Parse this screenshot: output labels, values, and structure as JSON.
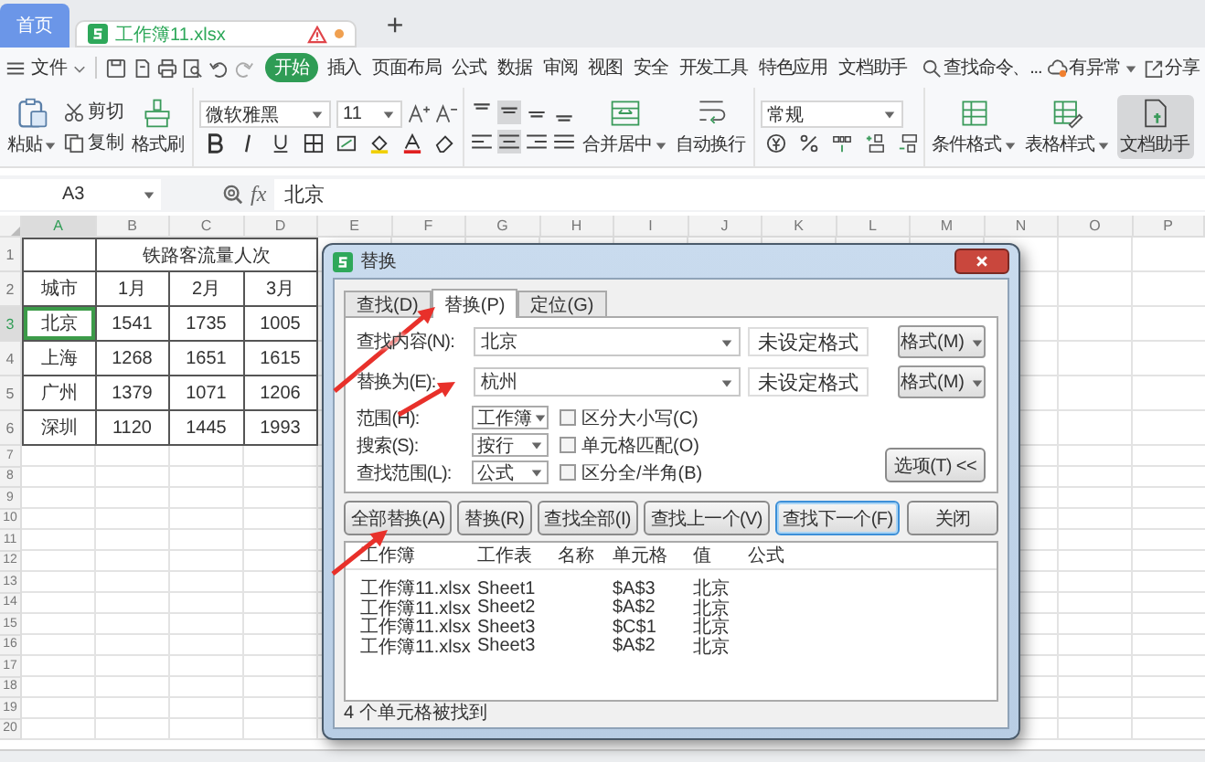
{
  "app_tabs": [
    {
      "label": "首页",
      "selected": false,
      "kind": "home"
    },
    {
      "label": "工作簿11.xlsx",
      "selected": true,
      "kind": "document"
    }
  ],
  "new_tab_button": "+",
  "menu": {
    "file": "文件",
    "tabs": [
      {
        "label": "开始",
        "selected": true
      },
      {
        "label": "插入",
        "selected": false
      },
      {
        "label": "页面布局",
        "selected": false
      },
      {
        "label": "公式",
        "selected": false
      },
      {
        "label": "数据",
        "selected": false
      },
      {
        "label": "审阅",
        "selected": false
      },
      {
        "label": "视图",
        "selected": false
      },
      {
        "label": "安全",
        "selected": false
      },
      {
        "label": "开发工具",
        "selected": false
      },
      {
        "label": "特色应用",
        "selected": false
      },
      {
        "label": "文档助手",
        "selected": false
      }
    ],
    "search": "查找命令、...",
    "status": "有异常",
    "share": "分享"
  },
  "ribbon": {
    "paste": "粘贴",
    "cut": "剪切",
    "copy": "复制",
    "format_painter": "格式刷",
    "font": "微软雅黑",
    "font_size": "11",
    "merge": "合并居中",
    "wrap": "自动换行",
    "number_format": "常规",
    "conditional_format": "条件格式",
    "table_style": "表格样式",
    "assistant": "文档助手"
  },
  "formula_bar": {
    "cell_reference": "A3",
    "fx": "fx",
    "value": "北京"
  },
  "sheet": {
    "columns": [
      {
        "label": "A",
        "selected": true
      },
      {
        "label": "B",
        "selected": false
      },
      {
        "label": "C",
        "selected": false
      },
      {
        "label": "D",
        "selected": false
      },
      {
        "label": "E",
        "selected": false
      },
      {
        "label": "F",
        "selected": false
      },
      {
        "label": "G",
        "selected": false
      },
      {
        "label": "H",
        "selected": false
      },
      {
        "label": "I",
        "selected": false
      },
      {
        "label": "J",
        "selected": false
      },
      {
        "label": "K",
        "selected": false
      },
      {
        "label": "L",
        "selected": false
      },
      {
        "label": "M",
        "selected": false
      },
      {
        "label": "N",
        "selected": false
      },
      {
        "label": "O",
        "selected": false
      },
      {
        "label": "P",
        "selected": false
      }
    ],
    "rows": [
      {
        "label": "1",
        "selected": false
      },
      {
        "label": "2",
        "selected": false
      },
      {
        "label": "3",
        "selected": true
      },
      {
        "label": "4",
        "selected": false
      },
      {
        "label": "5",
        "selected": false
      },
      {
        "label": "6",
        "selected": false
      },
      {
        "label": "7",
        "selected": false
      },
      {
        "label": "8",
        "selected": false
      },
      {
        "label": "9",
        "selected": false
      },
      {
        "label": "10",
        "selected": false
      },
      {
        "label": "11",
        "selected": false
      },
      {
        "label": "12",
        "selected": false
      },
      {
        "label": "13",
        "selected": false
      },
      {
        "label": "14",
        "selected": false
      },
      {
        "label": "15",
        "selected": false
      },
      {
        "label": "16",
        "selected": false
      },
      {
        "label": "17",
        "selected": false
      },
      {
        "label": "18",
        "selected": false
      },
      {
        "label": "19",
        "selected": false
      },
      {
        "label": "20",
        "selected": false
      }
    ],
    "title": "铁路客流量人次",
    "header": [
      "城市",
      "1月",
      "2月",
      "3月"
    ],
    "data": [
      [
        {
          "text": "北京",
          "selected": true
        },
        {
          "text": "1541",
          "selected": false
        },
        {
          "text": "1735",
          "selected": false
        },
        {
          "text": "1005",
          "selected": false
        }
      ],
      [
        {
          "text": "上海",
          "selected": false
        },
        {
          "text": "1268",
          "selected": false
        },
        {
          "text": "1651",
          "selected": false
        },
        {
          "text": "1615",
          "selected": false
        }
      ],
      [
        {
          "text": "广州",
          "selected": false
        },
        {
          "text": "1379",
          "selected": false
        },
        {
          "text": "1071",
          "selected": false
        },
        {
          "text": "1206",
          "selected": false
        }
      ],
      [
        {
          "text": "深圳",
          "selected": false
        },
        {
          "text": "1120",
          "selected": false
        },
        {
          "text": "1445",
          "selected": false
        },
        {
          "text": "1993",
          "selected": false
        }
      ]
    ]
  },
  "dialog": {
    "title": "替换",
    "tabs": [
      {
        "label": "查找(D)",
        "selected": false
      },
      {
        "label": "替换(P)",
        "selected": true
      },
      {
        "label": "定位(G)",
        "selected": false
      }
    ],
    "fields": [
      {
        "label": "查找内容(N):",
        "value": "北京",
        "format": "未设定格式",
        "format_button": "格式(M)"
      },
      {
        "label": "替换为(E):",
        "value": "杭州",
        "format": "未设定格式",
        "format_button": "格式(M)"
      }
    ],
    "options": [
      {
        "label": "范围(H):",
        "value": "工作簿",
        "checkbox": "区分大小写(C)",
        "checked": false
      },
      {
        "label": "搜索(S):",
        "value": "按行",
        "checkbox": "单元格匹配(O)",
        "checked": false
      },
      {
        "label": "查找范围(L):",
        "value": "公式",
        "checkbox": "区分全/半角(B)",
        "checked": false
      }
    ],
    "options_button": "选项(T) <<",
    "buttons": [
      {
        "label": "全部替换(A)",
        "focused": false
      },
      {
        "label": "替换(R)",
        "focused": false
      },
      {
        "label": "查找全部(I)",
        "focused": false
      },
      {
        "label": "查找上一个(V)",
        "focused": false
      },
      {
        "label": "查找下一个(F)",
        "focused": true
      }
    ],
    "close_button": "关闭",
    "results": {
      "columns": [
        "工作簿",
        "工作表",
        "名称",
        "单元格",
        "值",
        "公式"
      ],
      "rows": [
        {
          "workbook": "工作簿11.xlsx",
          "sheet": "Sheet1",
          "cell": "$A$3",
          "value": "北京"
        },
        {
          "workbook": "工作簿11.xlsx",
          "sheet": "Sheet2",
          "cell": "$A$2",
          "value": "北京"
        },
        {
          "workbook": "工作簿11.xlsx",
          "sheet": "Sheet3",
          "cell": "$C$1",
          "value": "北京"
        },
        {
          "workbook": "工作簿11.xlsx",
          "sheet": "Sheet3",
          "cell": "$A$2",
          "value": "北京"
        }
      ]
    },
    "status": "4 个单元格被找到"
  }
}
